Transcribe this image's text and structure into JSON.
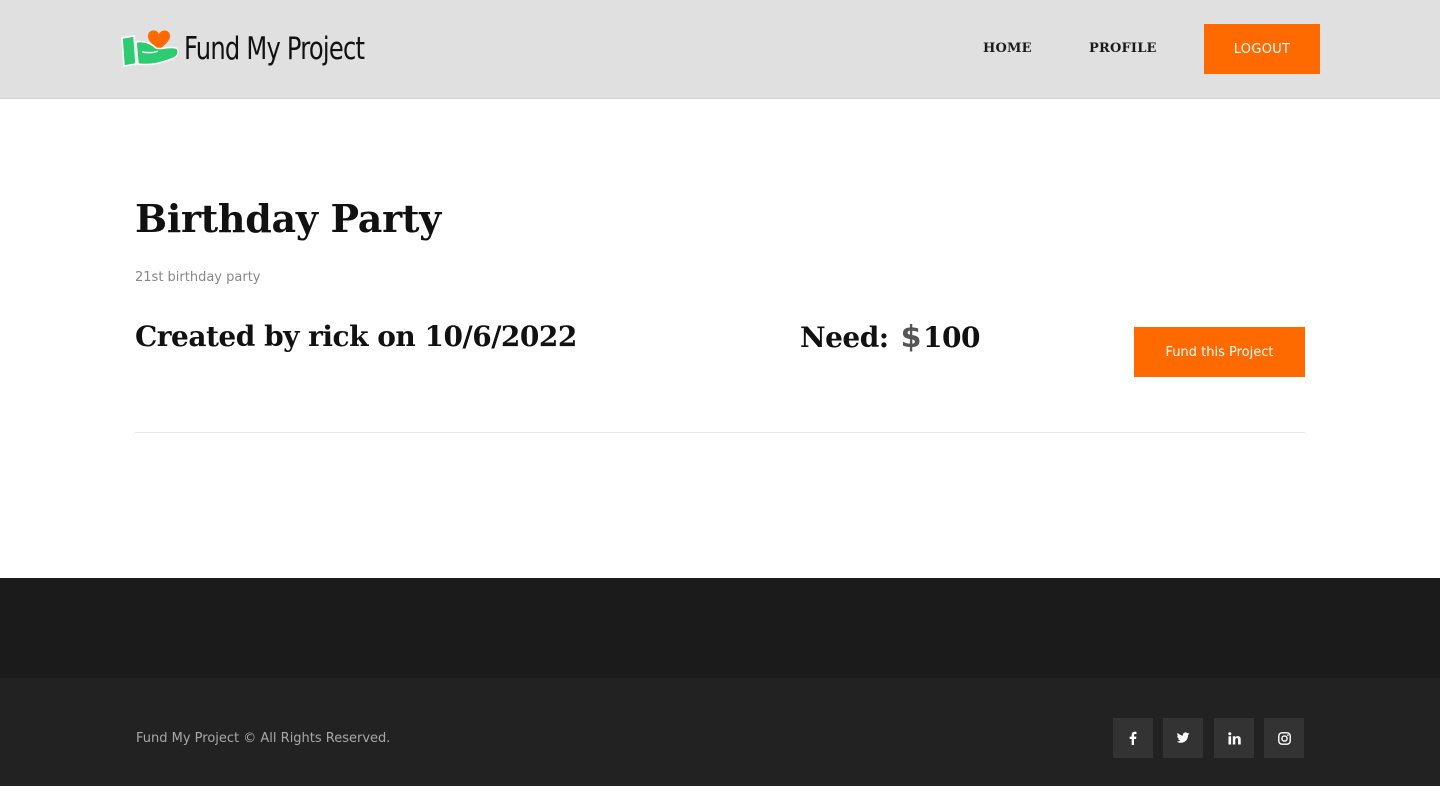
{
  "header": {
    "logo_text": "Fund My Project",
    "nav": {
      "home": "HOME",
      "profile": "PROFILE"
    },
    "logout_label": "LOGOUT"
  },
  "project": {
    "title": "Birthday Party",
    "description": "21st birthday party",
    "created_text": "Created by rick on 10/6/2022",
    "need_label": "Need:",
    "currency_symbol": "$",
    "need_amount": "100",
    "fund_button_label": "Fund this Project"
  },
  "footer": {
    "copyright": "Fund My Project © All Rights Reserved.",
    "social": [
      "facebook-icon",
      "twitter-icon",
      "linkedin-icon",
      "instagram-icon"
    ]
  },
  "colors": {
    "accent": "#ff6a00",
    "header_bg": "#e0e0e0",
    "footer_dark": "#1b1b1b",
    "footer_bottom": "#222222",
    "logo_green": "#2ecc71"
  }
}
